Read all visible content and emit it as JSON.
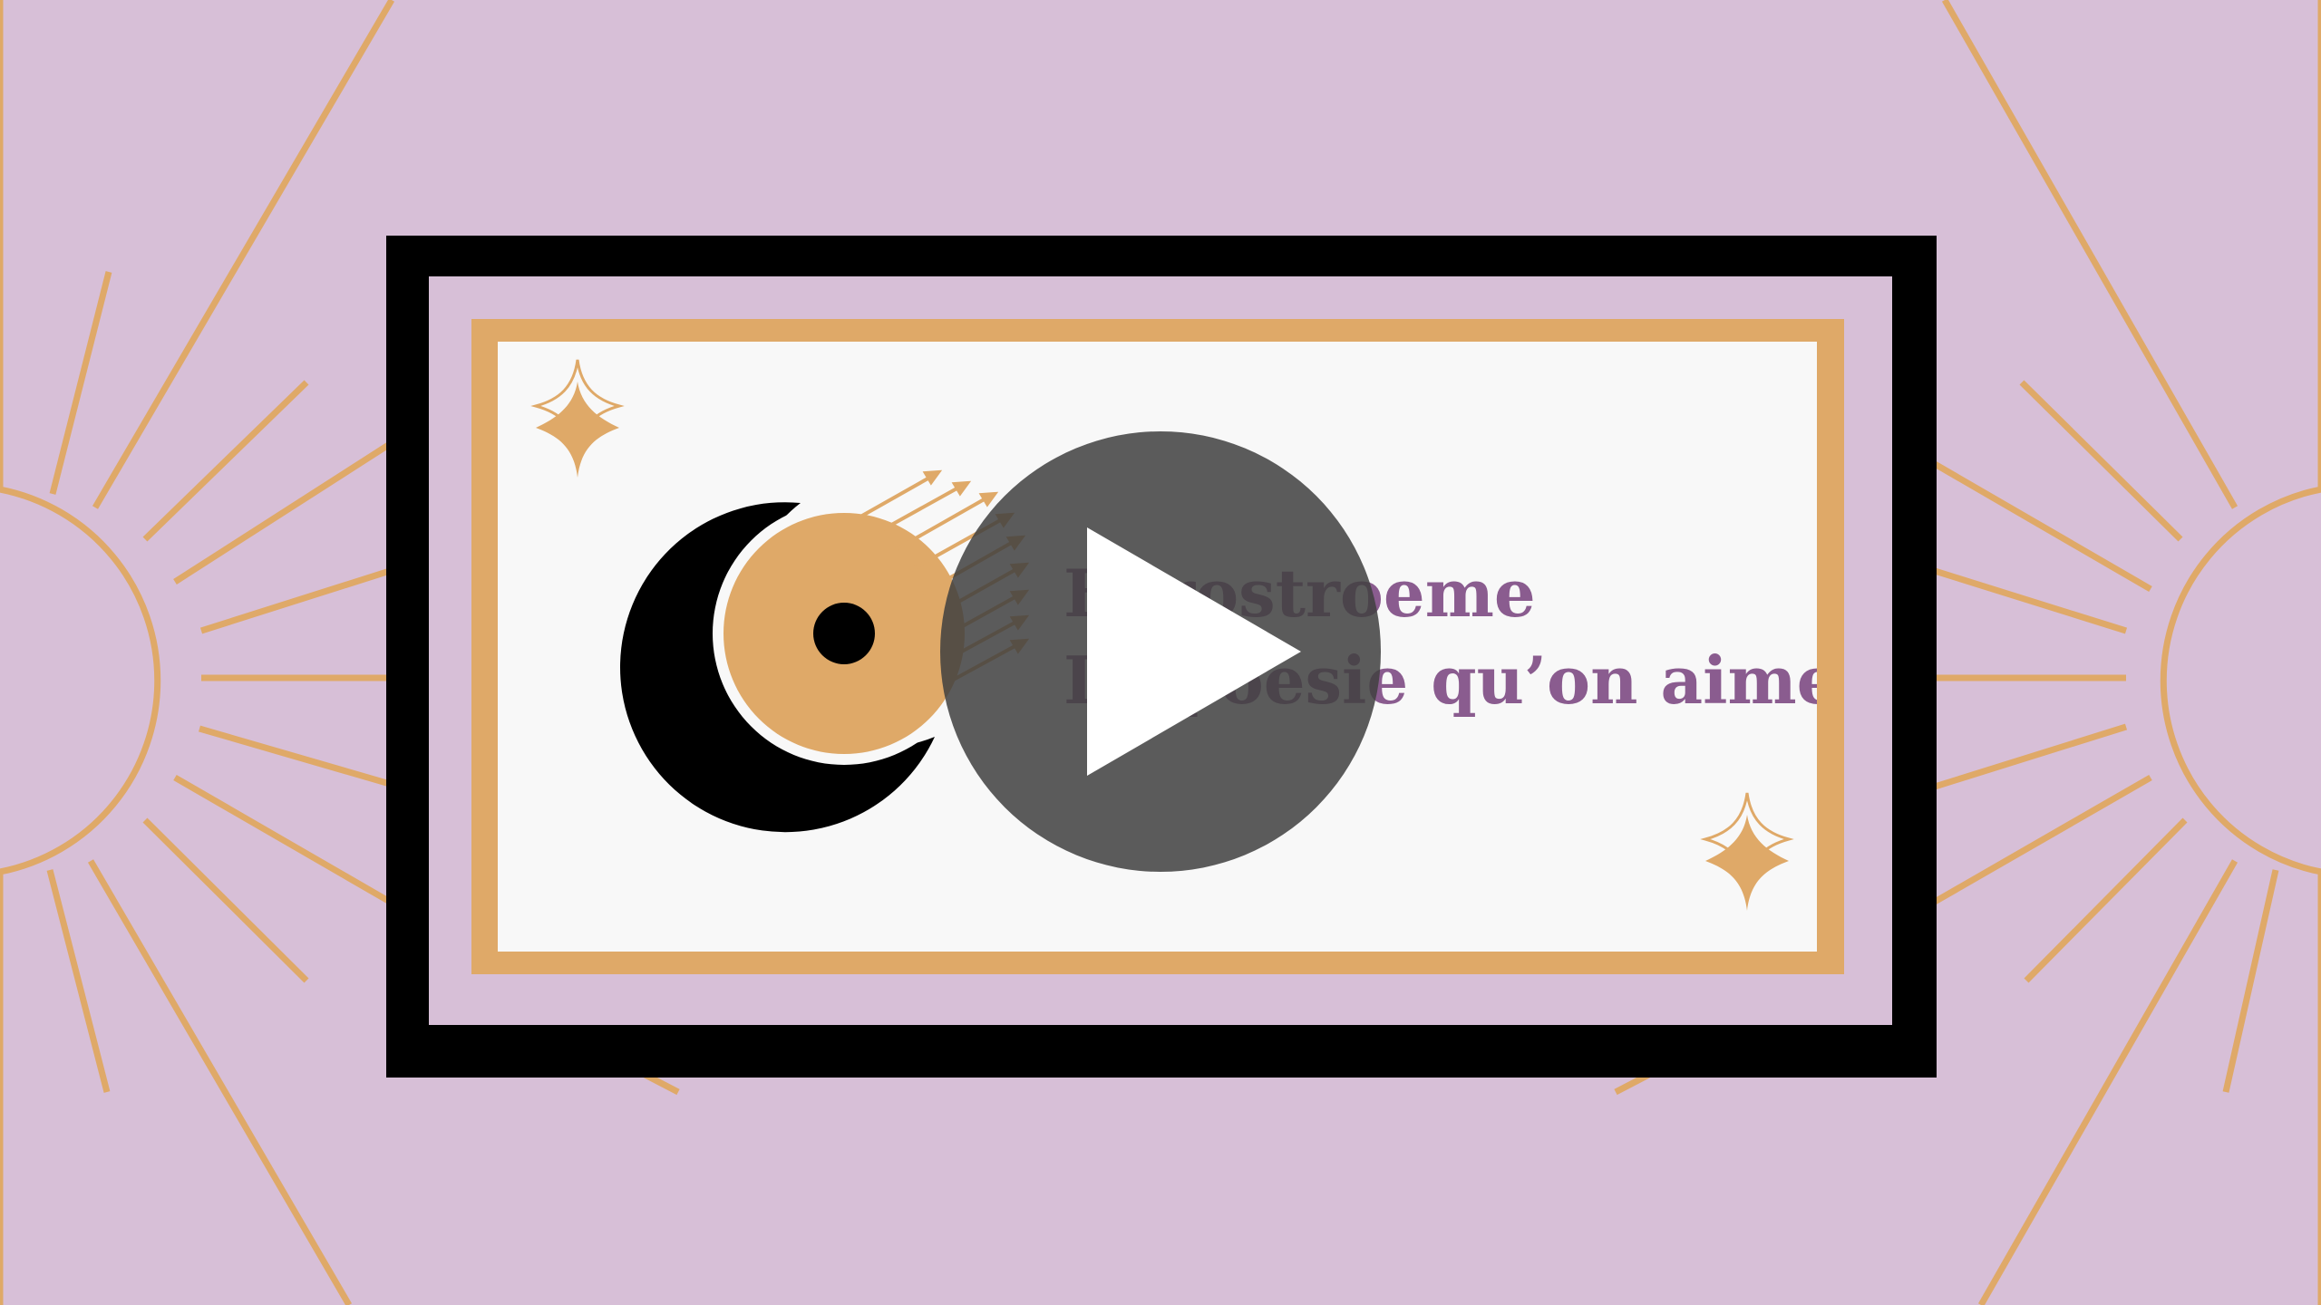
{
  "video": {
    "title_line_1": "Eurostroeme",
    "title_line_2": "La poesie qu’on aime",
    "play_icon": "play-icon"
  },
  "theme": {
    "background": "#d7bfd7",
    "gold": "#dfa968",
    "frame": "#000000",
    "card": "#f8f8f8",
    "title_color": "#8a5c8f",
    "play_overlay": "#404040"
  }
}
